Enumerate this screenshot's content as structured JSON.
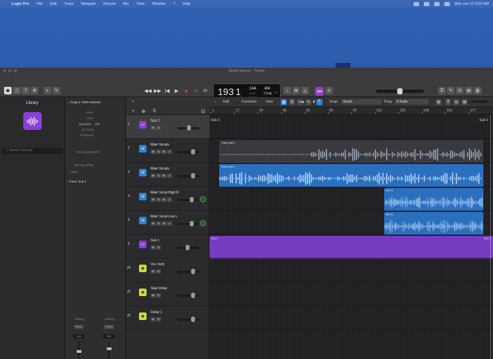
{
  "menubar": {
    "apple": "",
    "app": "Logic Pro",
    "items": [
      "File",
      "Edit",
      "Track",
      "Navigate",
      "Record",
      "Mix",
      "View",
      "Window",
      "?",
      "Help"
    ],
    "clock": "Mon Jun 10  9:02 AM"
  },
  "window": {
    "title": "Studio Session - Tracks"
  },
  "toolbar": {
    "lcd": {
      "bar": "193",
      "beat": "1",
      "bar_label": "BAR",
      "beat_label": "BEAT",
      "tempo": "144",
      "tempo_label": "KEEP",
      "tempo_sub": "TEMPO",
      "signature": "4/4",
      "key": "Cmaj"
    },
    "avatar_text": "104",
    "master_volume": 0.5
  },
  "library": {
    "title": "Library",
    "search_placeholder": "Search Sounds"
  },
  "inspector": {
    "region_header": "Region: MIDI Defaults",
    "mute": "Mute",
    "loop": "Loop",
    "quantize": "Quantize",
    "quantize_value": "Off",
    "q_swing": "Q-Swing",
    "transpose": "Transpose",
    "more": "More",
    "track_header": "Track:",
    "track_name": "Sub 2",
    "velocity": "Velocity Offset",
    "time_quantize": "Time Quantize",
    "time_quantize_value": "Off",
    "strip_left_setting": "Setting",
    "strip_right_setting": "Setting",
    "strip_left_read": "Read",
    "strip_right_read": "Read",
    "strip_left_value": "-1.0",
    "strip_right_value": "0.0"
  },
  "tracks": [
    {
      "num": "1",
      "name": "Sub 2",
      "color": "#8a3fd6",
      "icon": "folder-icon",
      "selected": true,
      "fader": 0.55,
      "disclosure": true,
      "buttons": [
        "M",
        "S"
      ]
    },
    {
      "num": "2",
      "name": "Main Vocals",
      "color": "#2a86d9",
      "icon": "waveform-icon",
      "selected": false,
      "fader": 0.78,
      "disclosure": false,
      "buttons": [
        "M",
        "S",
        "R",
        "I"
      ]
    },
    {
      "num": "3",
      "name": "Main Vocals",
      "color": "#2a86d9",
      "icon": "waveform-icon",
      "selected": false,
      "fader": 0.78,
      "disclosure": false,
      "buttons": [
        "M",
        "S",
        "R",
        "I"
      ]
    },
    {
      "num": "4",
      "name": "Main Vocal High R",
      "color": "#2a86d9",
      "icon": "waveform-icon",
      "selected": false,
      "fader": 0.7,
      "disclosure": false,
      "buttons": [
        "M",
        "S",
        "R",
        "I"
      ],
      "pan": true
    },
    {
      "num": "5",
      "name": "Main Vocal Low L",
      "color": "#2a86d9",
      "icon": "waveform-icon",
      "selected": false,
      "fader": 0.7,
      "disclosure": false,
      "buttons": [
        "M",
        "S",
        "R",
        "I"
      ],
      "pan": true
    },
    {
      "num": "6",
      "name": "Sub 1",
      "color": "#8a3fd6",
      "icon": "folder-icon",
      "selected": false,
      "fader": 0.45,
      "disclosure": true,
      "buttons": [
        "M",
        "S"
      ]
    },
    {
      "num": "24",
      "name": "Vox Verb",
      "color": "#d6dc3a",
      "icon": "aux-icon",
      "selected": false,
      "fader": 0.78,
      "disclosure": false,
      "buttons": [
        "M",
        "S"
      ]
    },
    {
      "num": "25",
      "name": "Slap Delay",
      "color": "#d6dc3a",
      "icon": "aux-icon",
      "selected": false,
      "fader": 0.78,
      "disclosure": false,
      "buttons": [
        "M",
        "S"
      ]
    },
    {
      "num": "26",
      "name": "Delay 1",
      "color": "#d6dc3a",
      "icon": "aux-icon",
      "selected": false,
      "fader": 0.78,
      "disclosure": false,
      "buttons": [
        "M",
        "S"
      ]
    }
  ],
  "arrange_toolbar": {
    "edit": "Edit",
    "functions": "Functions",
    "view": "View",
    "snap_label": "Snap:",
    "snap_value": "Smart",
    "drag_label": "Drag:",
    "drag_value": "X-Fade"
  },
  "ruler": [
    "1",
    "17",
    "33",
    "49",
    "65",
    "81",
    "97",
    "113",
    "129",
    "145",
    "161",
    "177"
  ],
  "regions": [
    {
      "lane": 0,
      "name": "Sub 2",
      "start": 0.0,
      "end": 1.0,
      "kind": "folder-label",
      "end_label": "Sub 2"
    },
    {
      "lane": 1,
      "name": "Track part 1",
      "start": 0.035,
      "end": 0.965,
      "kind": "audio-dark"
    },
    {
      "lane": 2,
      "name": "Track part 1",
      "start": 0.035,
      "end": 0.965,
      "kind": "audio-blue"
    },
    {
      "lane": 3,
      "name": "HPF.R",
      "start": 0.615,
      "end": 0.965,
      "kind": "audio-blue"
    },
    {
      "lane": 4,
      "name": "HPF.R",
      "start": 0.615,
      "end": 0.965,
      "kind": "audio-blue"
    },
    {
      "lane": 5,
      "name": "Sub 1",
      "start": 0.0,
      "end": 1.0,
      "kind": "folder",
      "end_label": "Sub 1"
    }
  ]
}
